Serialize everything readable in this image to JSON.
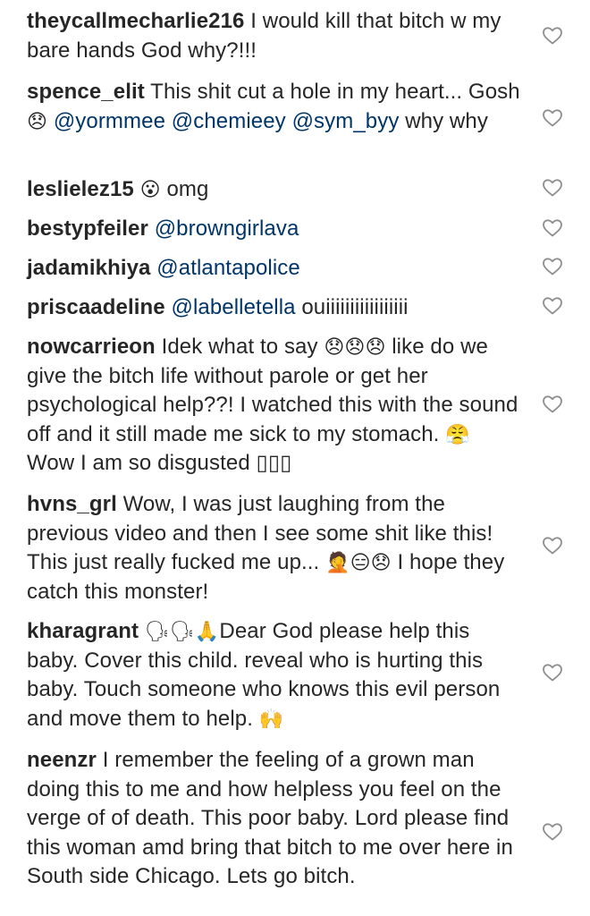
{
  "comments": [
    {
      "user": "theycallmecharlie216",
      "segments": [
        {
          "t": "text",
          "v": " I would kill that bitch w my bare hands God why?!!!"
        }
      ]
    },
    {
      "user": "spence_elit",
      "segments": [
        {
          "t": "text",
          "v": " This shit cut a hole in my heart... Gosh "
        },
        {
          "t": "emoji",
          "v": "😞"
        },
        {
          "t": "text",
          "v": " "
        },
        {
          "t": "mention",
          "v": "@yormmee"
        },
        {
          "t": "text",
          "v": " "
        },
        {
          "t": "mention",
          "v": "@chemieey"
        },
        {
          "t": "text",
          "v": " "
        },
        {
          "t": "mention",
          "v": "@sym_byy"
        },
        {
          "t": "text",
          "v": " why why"
        }
      ]
    },
    {
      "user": "leslielez15",
      "segments": [
        {
          "t": "text",
          "v": " "
        },
        {
          "t": "emoji",
          "v": "😮"
        },
        {
          "t": "text",
          "v": " omg"
        }
      ]
    },
    {
      "user": "bestypfeiler",
      "segments": [
        {
          "t": "text",
          "v": " "
        },
        {
          "t": "mention",
          "v": "@browngirlava"
        }
      ]
    },
    {
      "user": "jadamikhiya",
      "segments": [
        {
          "t": "text",
          "v": " "
        },
        {
          "t": "mention",
          "v": "@atlantapolice"
        }
      ]
    },
    {
      "user": "priscaadeline",
      "segments": [
        {
          "t": "text",
          "v": " "
        },
        {
          "t": "mention",
          "v": "@labelletella"
        },
        {
          "t": "text",
          "v": " ouiiiiiiiiiiiiiiiii"
        }
      ]
    },
    {
      "user": "nowcarrieon",
      "segments": [
        {
          "t": "text",
          "v": " Idek what to say "
        },
        {
          "t": "emoji",
          "v": "😞😞😞"
        },
        {
          "t": "text",
          "v": " like do we give the bitch life without parole or get her psychological help??! I watched this with the sound off and it still made me sick to my stomach. "
        },
        {
          "t": "emoji",
          "v": "😤"
        },
        {
          "t": "text",
          "v": " Wow I am so disgusted ▯▯▯"
        }
      ]
    },
    {
      "user": "hvns_grl",
      "segments": [
        {
          "t": "text",
          "v": " Wow, I was just laughing from the previous video and then I see some shit like this! This just really fucked me up... "
        },
        {
          "t": "emoji",
          "v": "🤦😑😞"
        },
        {
          "t": "text",
          "v": " I hope they catch this monster!"
        }
      ]
    },
    {
      "user": "kharagrant",
      "segments": [
        {
          "t": "text",
          "v": " "
        },
        {
          "t": "emoji",
          "v": "🗣🗣🙏"
        },
        {
          "t": "text",
          "v": "Dear God please help this baby. Cover this child. reveal who is hurting this baby. Touch someone who knows this evil person and move them to help. "
        },
        {
          "t": "emoji",
          "v": "🙌"
        }
      ]
    },
    {
      "user": "neenzr",
      "segments": [
        {
          "t": "text",
          "v": " I remember the feeling of a grown man doing this to me and how helpless you feel on the verge of of death. This poor baby. Lord please find this woman amd bring that bitch to me over here in South side Chicago. Lets go bitch."
        }
      ]
    }
  ]
}
